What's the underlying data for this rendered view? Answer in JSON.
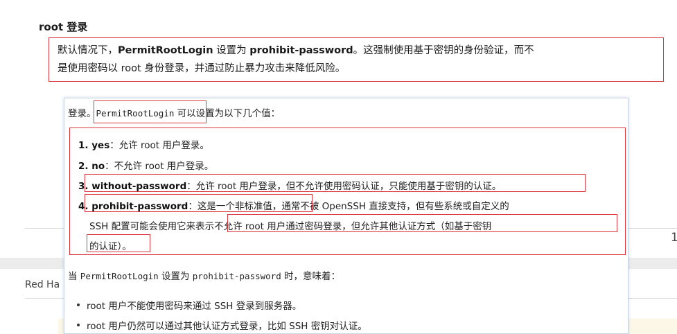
{
  "section_heading": "root 登录",
  "note": {
    "p1": "默认情况下，",
    "b1": "PermitRootLogin",
    "p2": " 设置为 ",
    "b2": "prohibit-password",
    "p3": "。这强制使用基于密钥的身份验证，而不",
    "p4": "是使用密码以 root 身份登录，并通过防止暴力攻击来降低风险。"
  },
  "background": {
    "brand_text": "Red Ha",
    "page_number": "1"
  },
  "popup": {
    "intro_prefix": "登录。",
    "intro_code": "PermitRootLogin",
    "intro_suffix": " 可以设置为以下几个值：",
    "items": [
      {
        "num": "1. ",
        "term": "yes",
        "desc": "：允许 root 用户登录。"
      },
      {
        "num": "2. ",
        "term": "no",
        "desc": "：不允许 root 用户登录。"
      },
      {
        "num": "3. ",
        "term": "without-password",
        "desc": "：允许 root 用户登录，但不允许使用密码认证，只能使用基于密钥的认证。"
      },
      {
        "num": "4. ",
        "term": "prohibit-password",
        "desc_a": "：这是一个非标准值，",
        "desc_b": "通常不被 OpenSSH 直接支持，但有些系统或自定义的",
        "desc_c": "SSH 配置可能会使用它来",
        "desc_d": "表示不允许 root 用户通过密码登录，但允许其他认证方式（如基于密钥",
        "desc_e": "的认证）。"
      }
    ],
    "summary_prefix": "当 ",
    "summary_code1": "PermitRootLogin",
    "summary_mid": " 设置为 ",
    "summary_code2": "prohibit-password",
    "summary_suffix": " 时，意味着：",
    "bullets": [
      "root 用户不能使用密码来通过 SSH 登录到服务器。",
      "root 用户仍然可以通过其他认证方式登录，比如 SSH 密钥对认证。"
    ]
  }
}
